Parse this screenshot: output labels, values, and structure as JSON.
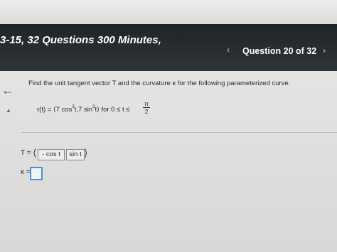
{
  "header": {
    "title": "3-15, 32 Questions 300 Minutes,",
    "question_counter": "Question 20 of 32",
    "prev_glyph": "‹",
    "next_glyph": "›"
  },
  "problem": {
    "prompt": "Find the unit tangent vector T and the curvature κ for the following parameterized curve.",
    "r_lhs": "r(t) = ",
    "r_open": "⟨",
    "r_c1": "7 cos",
    "r_exp1": "3",
    "r_c2": "t,7 sin",
    "r_exp2": "3",
    "r_c3": "t",
    "r_close": "⟩",
    "r_domain": " for 0 ≤ t ≤ ",
    "domain_num": "π",
    "domain_den": "2"
  },
  "answer": {
    "T_label": "T =",
    "T_open": "⟨",
    "T_comp1": "- cos t",
    "T_comp2": "sin t",
    "T_close": "⟩",
    "kappa_label": "κ ="
  },
  "icons": {
    "back": "back-arrow-icon",
    "collapse": "caret-up-icon",
    "prev": "chevron-left-icon",
    "next": "chevron-right-icon"
  }
}
